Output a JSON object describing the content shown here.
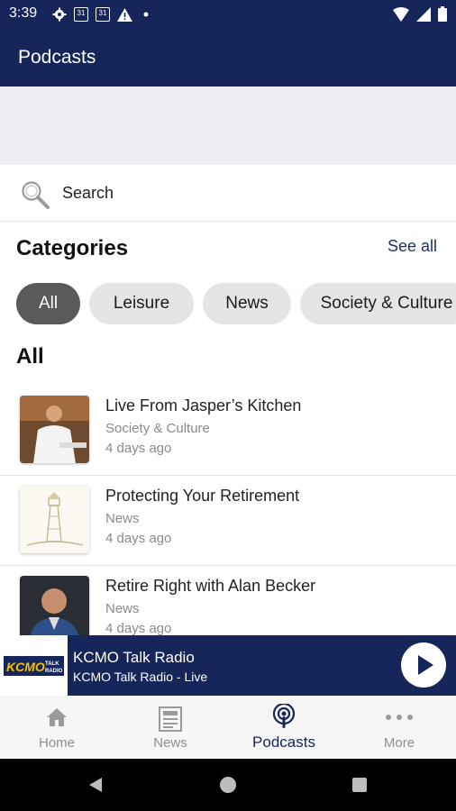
{
  "status_bar": {
    "time": "3:39",
    "calendar_day_1": "31",
    "calendar_day_2": "31"
  },
  "app_bar": {
    "title": "Podcasts"
  },
  "search": {
    "label": "Search"
  },
  "categories": {
    "title": "Categories",
    "see_all": "See all",
    "chips": [
      "All",
      "Leisure",
      "News",
      "Society & Culture"
    ]
  },
  "list_title": "All",
  "episodes": [
    {
      "title": "Live From Jasper’s Kitchen",
      "category": "Society & Culture",
      "date": "4 days ago"
    },
    {
      "title": "Protecting Your Retirement",
      "category": "News",
      "date": "4 days ago"
    },
    {
      "title": "Retire Right with Alan Becker",
      "category": "News",
      "date": "4 days ago"
    }
  ],
  "player": {
    "station": "KCMO Talk Radio",
    "subtitle": "KCMO Talk Radio - Live",
    "logo_text": "KCMO",
    "logo_sub": "TALK RADIO"
  },
  "bottom_nav": [
    {
      "label": "Home",
      "icon": "home-icon"
    },
    {
      "label": "News",
      "icon": "newspaper-icon"
    },
    {
      "label": "Podcasts",
      "icon": "podcast-icon"
    },
    {
      "label": "More",
      "icon": "more-dots-icon"
    }
  ],
  "colors": {
    "primary": "#16255a",
    "chip_active": "#5a5a5a",
    "chip": "#e5e5e5",
    "accent_link": "#1f2f66"
  }
}
